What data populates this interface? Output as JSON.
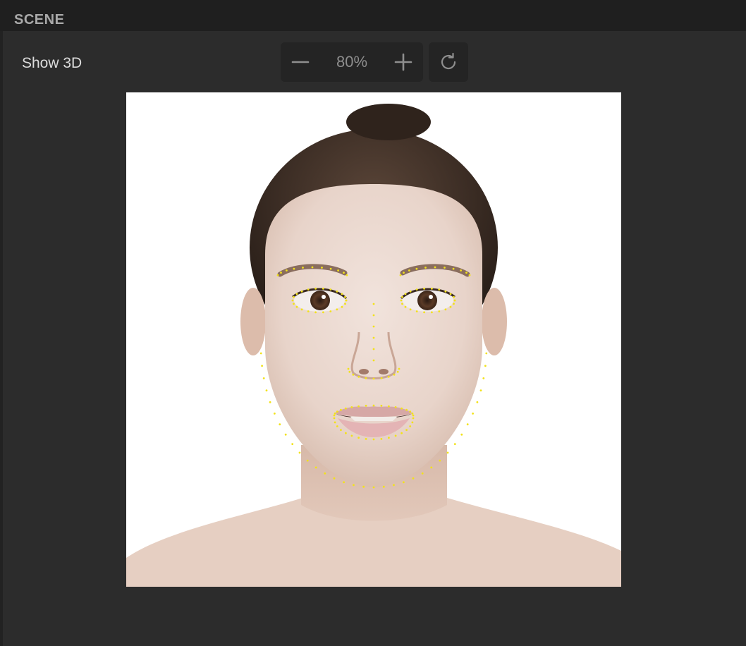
{
  "panel": {
    "title": "SCENE"
  },
  "toolbar": {
    "show_3d_label": "Show 3D",
    "zoom_value": "80%",
    "zoom_out_icon": "minus-icon",
    "zoom_in_icon": "plus-icon",
    "reset_icon": "refresh-icon"
  },
  "viewport": {
    "content": "face-photo-with-landmarks",
    "background_color": "#ffffff",
    "landmark_color": "#f2e21a"
  },
  "colors": {
    "header_bg": "#1f1f1f",
    "panel_bg": "#2c2c2c",
    "button_bg": "#242424",
    "icon_color": "#8e8e8e",
    "label_color": "#dcdcdc"
  }
}
